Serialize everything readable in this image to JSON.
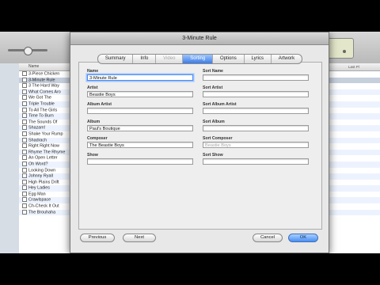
{
  "itunes": {
    "list_header": "Name",
    "right_header": "Last Pl",
    "tracks": [
      "3-Piece Chicken",
      "3-Minute Rule",
      "3 The Hard Way",
      "What Comes Aro",
      "We Got The",
      "Triple Trouble",
      "To All The Girls",
      "Time To Burn",
      "The Sounds Of",
      "Shazam!",
      "Shake Your Rump",
      "Shadrach",
      "Right Right Now",
      "Rhyme The Rhyme",
      "An Open Letter",
      "Oh Word?",
      "Looking Down",
      "Johnny Ryall",
      "High Plains Drift",
      "Hey Ladies",
      "Egg Man",
      "Crawlspace",
      "Ch-Check It Out",
      "The Brouhaha"
    ]
  },
  "dialog": {
    "title": "3-Minute Rule",
    "tabs": [
      "Summary",
      "Info",
      "Video",
      "Sorting",
      "Options",
      "Lyrics",
      "Artwork"
    ],
    "fields": {
      "name_label": "Name",
      "name_value": "3-Minute Rule",
      "sort_name_label": "Sort Name",
      "sort_name_value": "",
      "artist_label": "Artist",
      "artist_value": "Beastie Boys",
      "sort_artist_label": "Sort Artist",
      "sort_artist_value": "",
      "album_artist_label": "Album Artist",
      "album_artist_value": "",
      "sort_album_artist_label": "Sort Album Artist",
      "sort_album_artist_value": "",
      "album_label": "Album",
      "album_value": "Paul's Boutique",
      "sort_album_label": "Sort Album",
      "sort_album_value": "",
      "composer_label": "Composer",
      "composer_value": "The Beastie Boys",
      "sort_composer_label": "Sort Composer",
      "sort_composer_placeholder": "Beastie Boys",
      "show_label": "Show",
      "show_value": "",
      "sort_show_label": "Sort Show",
      "sort_show_value": ""
    },
    "buttons": {
      "previous": "Previous",
      "next": "Next",
      "cancel": "Cancel",
      "ok": "OK"
    }
  }
}
